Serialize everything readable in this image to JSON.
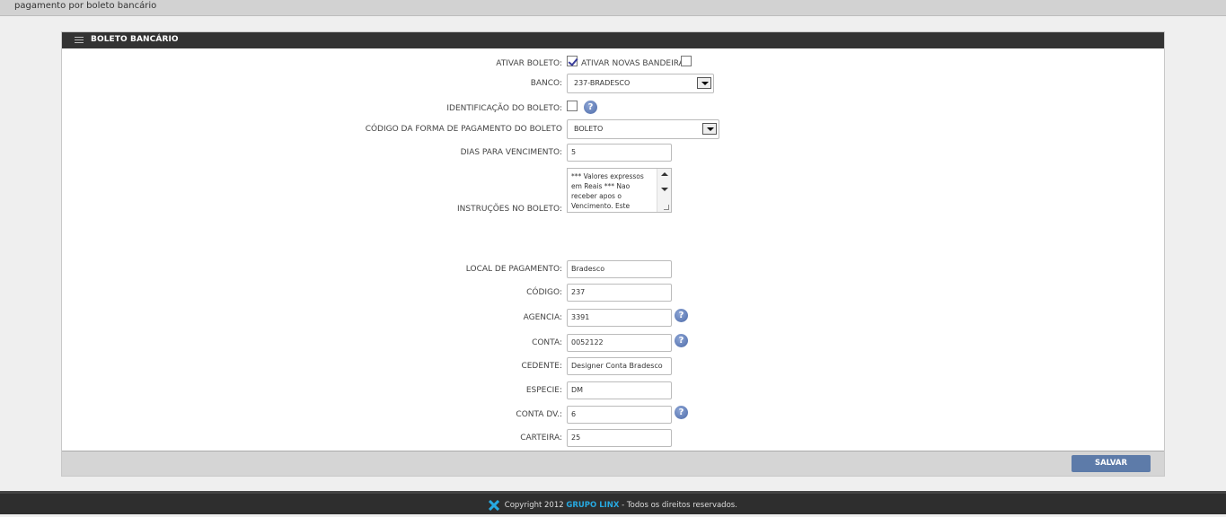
{
  "topbar": {
    "title": "pagamento por boleto bancário"
  },
  "panel": {
    "title": "BOLETO BANCÁRIO",
    "ativar_boleto": {
      "label": "ATIVAR BOLETO:",
      "checked": true
    },
    "ativar_bandeiras": {
      "label": "ATIVAR NOVAS BANDEIRAS:",
      "checked": false
    },
    "banco": {
      "label": "BANCO:",
      "value": "237-BRADESCO"
    },
    "identificacao": {
      "label": "IDENTIFICAÇÃO DO BOLETO:",
      "checked": false
    },
    "codigo_forma": {
      "label": "CÓDIGO DA FORMA DE PAGAMENTO DO BOLETO",
      "value": "BOLETO"
    },
    "dias_vencimento": {
      "label": "DIAS PARA VENCIMENTO:",
      "value": "5"
    },
    "instrucoes": {
      "label": "INSTRUÇÕES NO BOLETO:",
      "value": "*** Valores expressos em Reais *** Nao receber apos o Vencimento.    Este"
    },
    "local_pagamento": {
      "label": "LOCAL DE PAGAMENTO:",
      "value": "Bradesco"
    },
    "codigo": {
      "label": "CÓDIGO:",
      "value": "237"
    },
    "agencia": {
      "label": "AGENCIA:",
      "value": "3391"
    },
    "conta": {
      "label": "CONTA:",
      "value": "0052122"
    },
    "cedente": {
      "label": "CEDENTE:",
      "value": "Designer Conta Bradesco"
    },
    "especie": {
      "label": "ESPECIE:",
      "value": "DM"
    },
    "conta_dv": {
      "label": "CONTA DV.:",
      "value": "6"
    },
    "carteira": {
      "label": "CARTEIRA:",
      "value": "25"
    },
    "help_glyph": "?",
    "save_label": "SALVAR"
  },
  "footer": {
    "copyright": "Copyright 2012",
    "brand": "GRUPO LINX",
    "rest": "- Todos os direitos reservados."
  },
  "colors": {
    "header": "#333333",
    "save_button": "#5d7ba9",
    "brand": "#27a9e1",
    "help_icon": "#4c6aa8"
  }
}
